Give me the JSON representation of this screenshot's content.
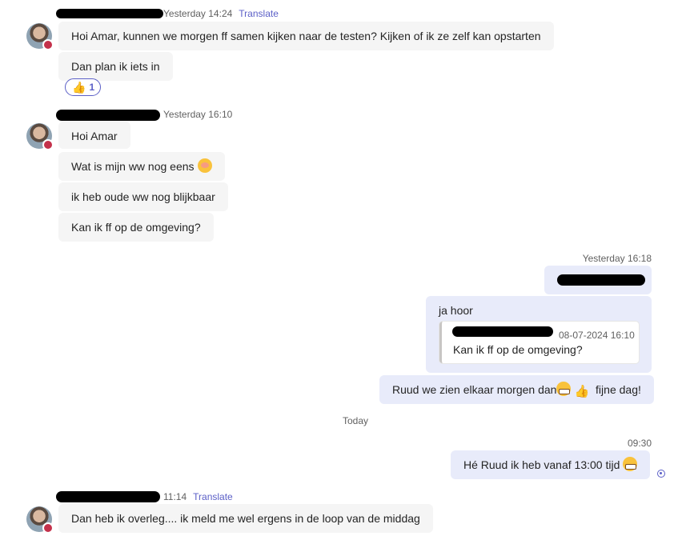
{
  "thread": {
    "group1": {
      "time": "Yesterday 14:24",
      "translate": "Translate",
      "messages": [
        "Hoi Amar, kunnen we morgen ff samen kijken naar de testen? Kijken of ik ze zelf kan opstarten",
        "Dan plan ik iets in"
      ],
      "reaction": {
        "emoji": "thumbs-up-icon",
        "count": "1"
      }
    },
    "group2": {
      "time": "Yesterday 16:10",
      "messages": [
        "Hoi Amar",
        "Wat is mijn ww nog eens",
        "ik heb oude ww nog blijkbaar",
        "Kan ik ff op de omgeving?"
      ]
    },
    "group3": {
      "time": "Yesterday 16:18",
      "reply_text": "ja hoor",
      "quote": {
        "time": "08-07-2024 16:10",
        "text": "Kan ik ff op de omgeving?"
      },
      "message_before": "Ruud we zien elkaar morgen dan",
      "message_after": "fijne dag!"
    },
    "divider": "Today",
    "group4": {
      "time": "09:30",
      "message": "Hé Ruud ik heb vanaf 13:00 tijd"
    },
    "group5": {
      "time": "11:14",
      "translate": "Translate",
      "message": "Dan heb ik overleg.... ik meld me wel ergens in de loop van de middag"
    }
  },
  "colors": {
    "accent": "#5b5fc7",
    "my_bubble": "#e8ebfa",
    "their_bubble": "#f5f5f5",
    "presence_busy": "#c4314b"
  }
}
